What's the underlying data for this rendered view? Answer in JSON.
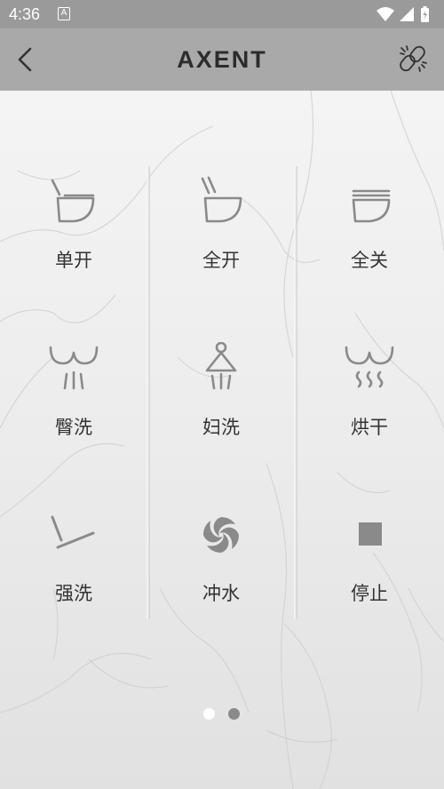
{
  "status": {
    "time": "4:36",
    "notif": "A"
  },
  "header": {
    "title": "AXENT",
    "back_icon": "chevron-left-icon",
    "link_icon": "link-icon"
  },
  "grid": [
    {
      "label": "单开",
      "icon": "lid-open-icon"
    },
    {
      "label": "全开",
      "icon": "seat-lid-open-icon"
    },
    {
      "label": "全关",
      "icon": "all-closed-icon"
    },
    {
      "label": "臀洗",
      "icon": "rear-wash-icon"
    },
    {
      "label": "妇洗",
      "icon": "front-wash-icon"
    },
    {
      "label": "烘干",
      "icon": "dry-icon"
    },
    {
      "label": "强洗",
      "icon": "strong-wash-icon"
    },
    {
      "label": "冲水",
      "icon": "flush-icon"
    },
    {
      "label": "停止",
      "icon": "stop-icon"
    }
  ],
  "pager": {
    "pages": 2,
    "current": 1
  }
}
